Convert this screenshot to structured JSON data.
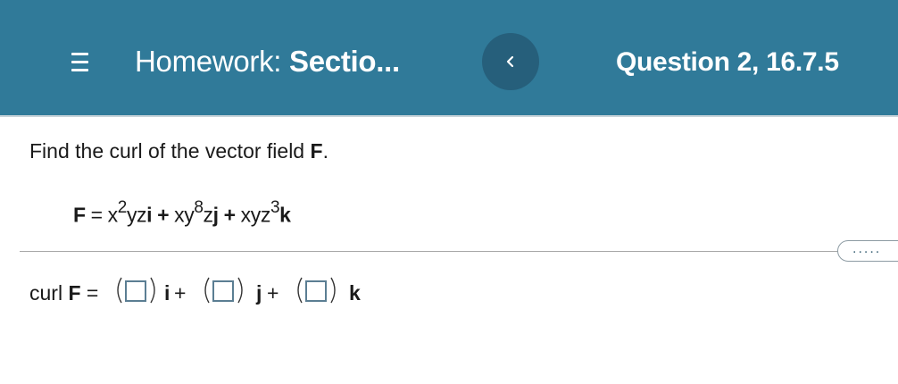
{
  "header": {
    "title_prefix": "Homework:",
    "title_bold": "Sectio...",
    "question": "Question 2, 16.7.5",
    "icons": {
      "menu": "hamburger-menu-icon",
      "back": "chevron-left-icon"
    }
  },
  "question": {
    "prompt_text": "Find the curl of the vector field",
    "prompt_field": "F",
    "prompt_end": ".",
    "formula": {
      "lhs": "F",
      "eq": " = ",
      "t1_a": "x",
      "t1_exp": "2",
      "t1_b": "yz",
      "t1_unit": "i",
      "plus1": " + ",
      "t2_a": "xy",
      "t2_exp": "8",
      "t2_b": "z",
      "t2_unit": "j",
      "plus2": " + ",
      "t3_a": "xyz",
      "t3_exp": "3",
      "t3_unit": "k"
    }
  },
  "toolbar": {
    "more_label": "....."
  },
  "answer": {
    "label": "curl",
    "field": "F",
    "eq": " =",
    "unit_i": "i",
    "unit_j": "j",
    "unit_k": "k",
    "plus": "+",
    "inputs": [
      "",
      "",
      ""
    ]
  },
  "colors": {
    "header": "#307a99",
    "back_button": "#265f7b",
    "input_border": "#5b7e93"
  }
}
